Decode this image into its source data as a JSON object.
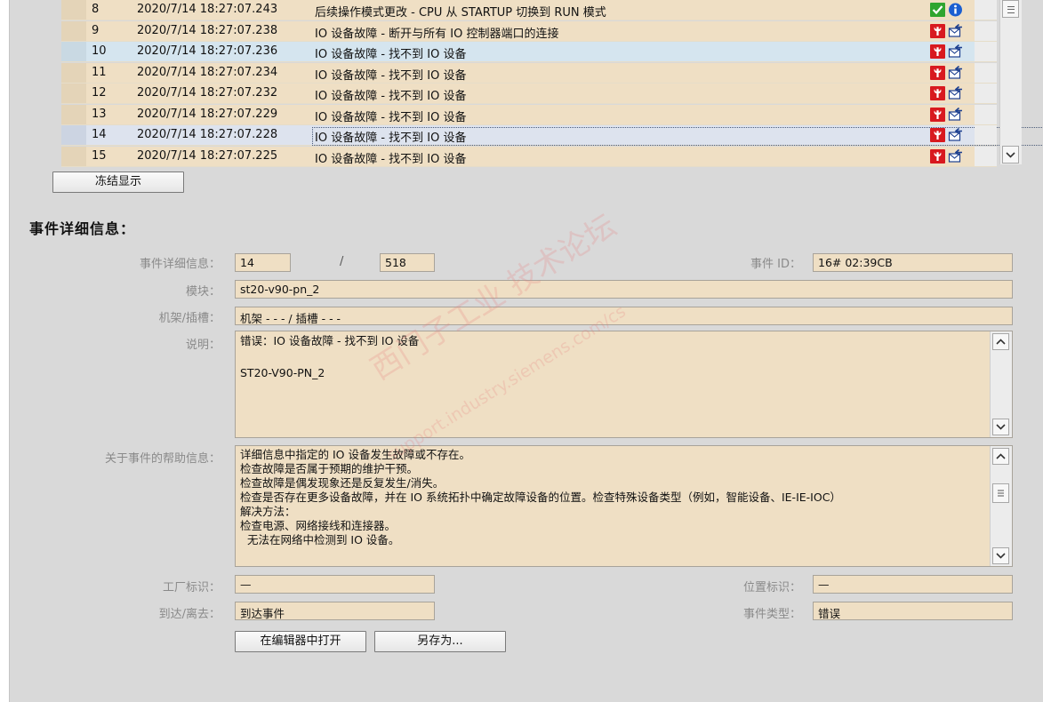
{
  "events": [
    {
      "num": "8",
      "timestamp": "2020/7/14 18:27:07.243",
      "message": "后续操作模式更改 - CPU 从 STARTUP 切换到 RUN 模式",
      "row_style": "tan",
      "icons": [
        "check-icon",
        "info-icon"
      ]
    },
    {
      "num": "9",
      "timestamp": "2020/7/14 18:27:07.238",
      "message": "IO 设备故障 - 断开与所有 IO 控制器端口的连接",
      "row_style": "tan",
      "icons": [
        "wrench-icon",
        "envelope-arrow-icon"
      ]
    },
    {
      "num": "10",
      "timestamp": "2020/7/14 18:27:07.236",
      "message": "IO 设备故障 - 找不到 IO 设备",
      "row_style": "blue",
      "icons": [
        "wrench-icon",
        "envelope-arrow-icon"
      ]
    },
    {
      "num": "11",
      "timestamp": "2020/7/14 18:27:07.234",
      "message": "IO 设备故障 - 找不到 IO 设备",
      "row_style": "tan",
      "icons": [
        "wrench-icon",
        "envelope-arrow-icon"
      ]
    },
    {
      "num": "12",
      "timestamp": "2020/7/14 18:27:07.232",
      "message": "IO 设备故障 - 找不到 IO 设备",
      "row_style": "tan",
      "icons": [
        "wrench-icon",
        "envelope-arrow-icon"
      ]
    },
    {
      "num": "13",
      "timestamp": "2020/7/14 18:27:07.229",
      "message": "IO 设备故障 - 找不到 IO 设备",
      "row_style": "tan",
      "icons": [
        "wrench-icon",
        "envelope-arrow-icon"
      ]
    },
    {
      "num": "14",
      "timestamp": "2020/7/14 18:27:07.228",
      "message": "IO 设备故障 - 找不到 IO 设备",
      "row_style": "selected",
      "icons": [
        "wrench-icon",
        "envelope-arrow-icon"
      ]
    },
    {
      "num": "15",
      "timestamp": "2020/7/14 18:27:07.225",
      "message": "IO 设备故障 - 找不到 IO 设备",
      "row_style": "tan",
      "icons": [
        "wrench-icon",
        "envelope-arrow-icon"
      ]
    }
  ],
  "freeze_button_label": "冻结显示",
  "details": {
    "section_title": "事件详细信息：",
    "event_detail_label": "事件详细信息：",
    "event_index": "14",
    "separator": "/",
    "event_total": "518",
    "event_id_label": "事件 ID：",
    "event_id": "16# 02:39CB",
    "module_label": "模块：",
    "module": "st20-v90-pn_2",
    "rack_slot_label": "机架/插槽：",
    "rack_slot": "机架 - - - / 插槽 - - -",
    "description_label": "说明：",
    "description_lines": [
      "错误：IO 设备故障 - 找不到 IO 设备",
      "",
      "ST20-V90-PN_2"
    ],
    "help_label": "关于事件的帮助信息：",
    "help_lines": [
      "详细信息中指定的 IO 设备发生故障或不存在。",
      "检查故障是否属于预期的维护干预。",
      "检查故障是偶发现象还是反复发生/消失。",
      "检查是否存在更多设备故障，并在 IO 系统拓扑中确定故障设备的位置。检查特殊设备类型（例如，智能设备、IE-IE-IOC）",
      "解决方法：",
      "检查电源、网络接线和连接器。",
      "  无法在网络中检测到 IO 设备。"
    ],
    "plant_id_label": "工厂标识：",
    "plant_id": "—",
    "location_id_label": "位置标识：",
    "location_id": "—",
    "arrive_leave_label": "到达/离去：",
    "arrive_leave": "到达事件",
    "event_type_label": "事件类型：",
    "event_type": "错误",
    "open_in_editor_label": "在编辑器中打开",
    "save_as_label": "另存为..."
  },
  "watermark": {
    "text_cn": "西门子工业 技术论坛",
    "text_url": "support.industry.siemens.com/cs"
  },
  "colors": {
    "row_tan": "#efdfc4",
    "row_blue": "#d5e5ef",
    "row_selected": "#dde3ee",
    "panel_bg": "#d9d9d9",
    "field_bg": "#efdfc4",
    "error_red": "#d8191f",
    "info_blue": "#1b5fd1",
    "ok_green": "#2fa52f"
  }
}
